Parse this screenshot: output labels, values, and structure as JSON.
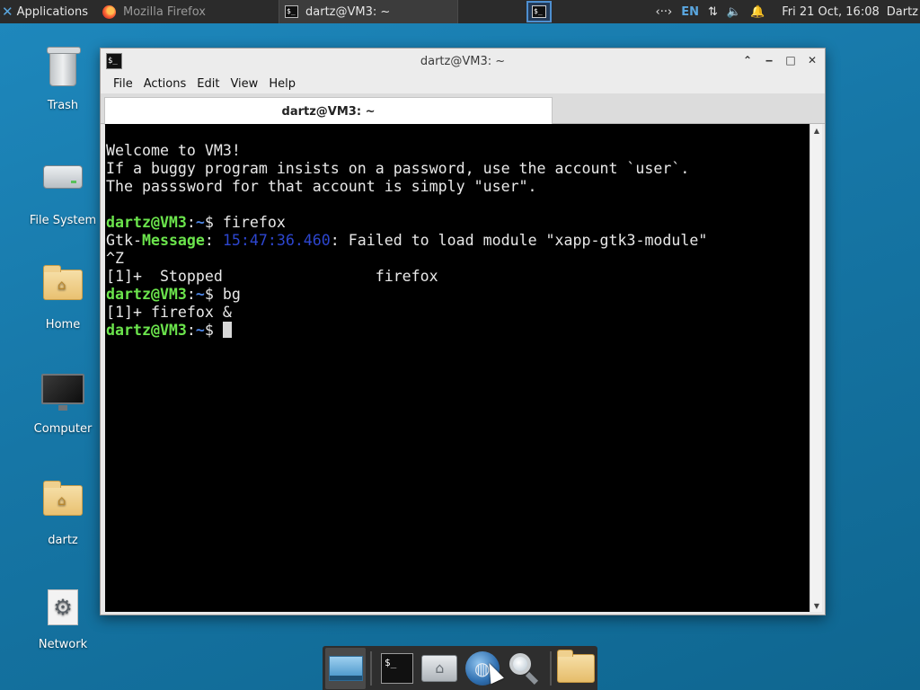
{
  "top_panel": {
    "applications_label": "Applications",
    "tasks": [
      {
        "title": "Mozilla Firefox",
        "icon": "firefox-icon"
      },
      {
        "title": "dartz@VM3: ~",
        "icon": "terminal-icon"
      }
    ],
    "indicators": {
      "network": "‹··›",
      "keyboard_layout": "EN",
      "transfer": "⇅",
      "volume": "🔈",
      "notifications": "🔔"
    },
    "clock": "Fri 21 Oct, 16:08",
    "user": "Dartz"
  },
  "desktop_icons": [
    {
      "label": "Trash",
      "icon": "trash-icon"
    },
    {
      "label": "File System",
      "icon": "drive-icon"
    },
    {
      "label": "Home",
      "icon": "home-folder-icon"
    },
    {
      "label": "Computer",
      "icon": "computer-icon"
    },
    {
      "label": "dartz",
      "icon": "home-folder-icon"
    },
    {
      "label": "Network",
      "icon": "network-icon"
    }
  ],
  "terminal_window": {
    "title": "dartz@VM3: ~",
    "menu": [
      "File",
      "Actions",
      "Edit",
      "View",
      "Help"
    ],
    "tab_label": "dartz@VM3: ~",
    "lines": {
      "welcome": "Welcome to VM3!",
      "line2": "If a buggy program insists on a password, use the account `user`.",
      "line3": "The passsword for that account is simply \"user\".",
      "prompt_user": "dartz@VM3",
      "prompt_sep": ":",
      "prompt_path": "~",
      "prompt_dollar": "$ ",
      "cmd1": "firefox",
      "gtk_key_a": "Gtk-",
      "gtk_key_b": "Message",
      "gtk_colon": ": ",
      "gtk_time": "15:47:36.460",
      "gtk_rest": ": Failed to load module \"xapp-gtk3-module\"",
      "ctrl_z": "^Z",
      "stopped": "[1]+  Stopped                 firefox",
      "cmd2": "bg",
      "bg_result": "[1]+ firefox &"
    }
  },
  "dock": {
    "items": [
      "show-desktop-icon",
      "terminal-icon",
      "file-manager-icon",
      "web-browser-icon",
      "search-icon",
      "folder-icon"
    ]
  }
}
